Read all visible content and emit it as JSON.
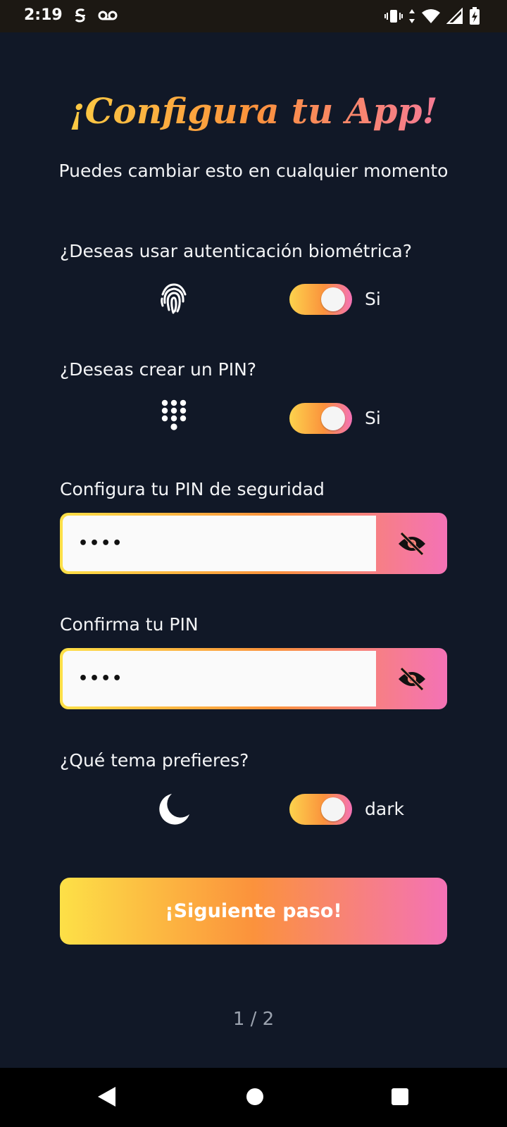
{
  "status_bar": {
    "time": "2:19",
    "left_icons": [
      "s-app-icon",
      "voicemail-icon"
    ],
    "right_icons": [
      "vibrate-icon",
      "data-arrows-icon",
      "wifi-icon",
      "signal-icon",
      "battery-charging-icon"
    ]
  },
  "header": {
    "title": "¡Configura tu App!",
    "subtitle": "Puedes cambiar esto en cualquier momento"
  },
  "biometric": {
    "question": "¿Deseas usar autenticación biométrica?",
    "icon": "fingerprint-icon",
    "toggle_on": true,
    "toggle_label": "Si"
  },
  "pin_option": {
    "question": "¿Deseas crear un PIN?",
    "icon": "dialpad-icon",
    "toggle_on": true,
    "toggle_label": "Si"
  },
  "pin_field": {
    "label": "Configura tu PIN de seguridad",
    "value": "••••",
    "toggle_icon": "eye-off-icon"
  },
  "confirm_field": {
    "label": "Confirma tu PIN",
    "value": "••••",
    "toggle_icon": "eye-off-icon"
  },
  "theme": {
    "question": "¿Qué tema prefieres?",
    "icon": "moon-icon",
    "toggle_on": true,
    "toggle_label": "dark"
  },
  "next_button": {
    "label": "¡Siguiente paso!"
  },
  "pager": {
    "text": "1 / 2"
  },
  "colors": {
    "background": "#111827",
    "gradient_start": "#fde047",
    "gradient_mid": "#fb923c",
    "gradient_end": "#f472b6"
  }
}
